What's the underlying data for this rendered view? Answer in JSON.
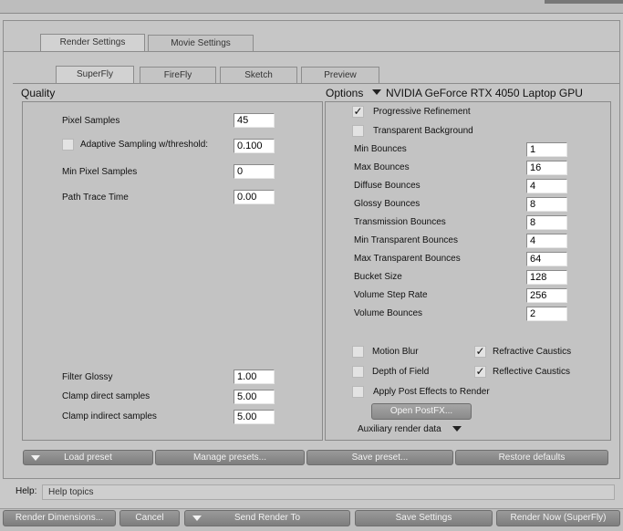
{
  "tabs_main": {
    "render_settings": "Render Settings",
    "movie_settings": "Movie Settings"
  },
  "tabs_engine": {
    "superfly": "SuperFly",
    "firefly": "FireFly",
    "sketch": "Sketch",
    "preview": "Preview"
  },
  "quality": {
    "title": "Quality",
    "pixel_samples": {
      "label": "Pixel Samples",
      "value": "45"
    },
    "adaptive_sampling": {
      "label": "Adaptive Sampling w/threshold:",
      "value": "0.100",
      "checked": false
    },
    "min_pixel_samples": {
      "label": "Min Pixel Samples",
      "value": "0"
    },
    "path_trace_time": {
      "label": "Path Trace Time",
      "value": "0.00"
    },
    "filter_glossy": {
      "label": "Filter Glossy",
      "value": "1.00"
    },
    "clamp_direct": {
      "label": "Clamp direct samples",
      "value": "5.00"
    },
    "clamp_indirect": {
      "label": "Clamp indirect samples",
      "value": "5.00"
    }
  },
  "options": {
    "title": "Options",
    "device": "NVIDIA GeForce RTX 4050 Laptop GPU",
    "progressive_refinement": {
      "label": "Progressive Refinement",
      "checked": true
    },
    "transparent_background": {
      "label": "Transparent Background",
      "checked": false
    },
    "fields": [
      {
        "label": "Min Bounces",
        "value": "1"
      },
      {
        "label": "Max Bounces",
        "value": "16"
      },
      {
        "label": "Diffuse Bounces",
        "value": "4"
      },
      {
        "label": "Glossy Bounces",
        "value": "8"
      },
      {
        "label": "Transmission Bounces",
        "value": "8"
      },
      {
        "label": "Min Transparent Bounces",
        "value": "4"
      },
      {
        "label": "Max Transparent Bounces",
        "value": "64"
      },
      {
        "label": "Bucket Size",
        "value": "128"
      },
      {
        "label": "Volume Step Rate",
        "value": "256"
      },
      {
        "label": "Volume Bounces",
        "value": "2"
      }
    ],
    "motion_blur": {
      "label": "Motion Blur",
      "checked": false
    },
    "refractive_caustics": {
      "label": "Refractive Caustics",
      "checked": true
    },
    "depth_of_field": {
      "label": "Depth of Field",
      "checked": false
    },
    "reflective_caustics": {
      "label": "Reflective Caustics",
      "checked": true
    },
    "apply_post_effects": {
      "label": "Apply Post Effects to Render",
      "checked": false
    },
    "open_postfx": "Open PostFX...",
    "auxiliary": "Auxiliary render data"
  },
  "presets": {
    "load": "Load preset",
    "manage": "Manage presets...",
    "save": "Save preset...",
    "restore": "Restore defaults"
  },
  "help": {
    "label": "Help:",
    "text": "Help topics"
  },
  "footer": {
    "render_dimensions": "Render Dimensions...",
    "cancel": "Cancel",
    "send_render_to": "Send Render To",
    "save_settings": "Save Settings",
    "render_now": "Render Now (SuperFly)"
  },
  "check_glyph": "✓"
}
